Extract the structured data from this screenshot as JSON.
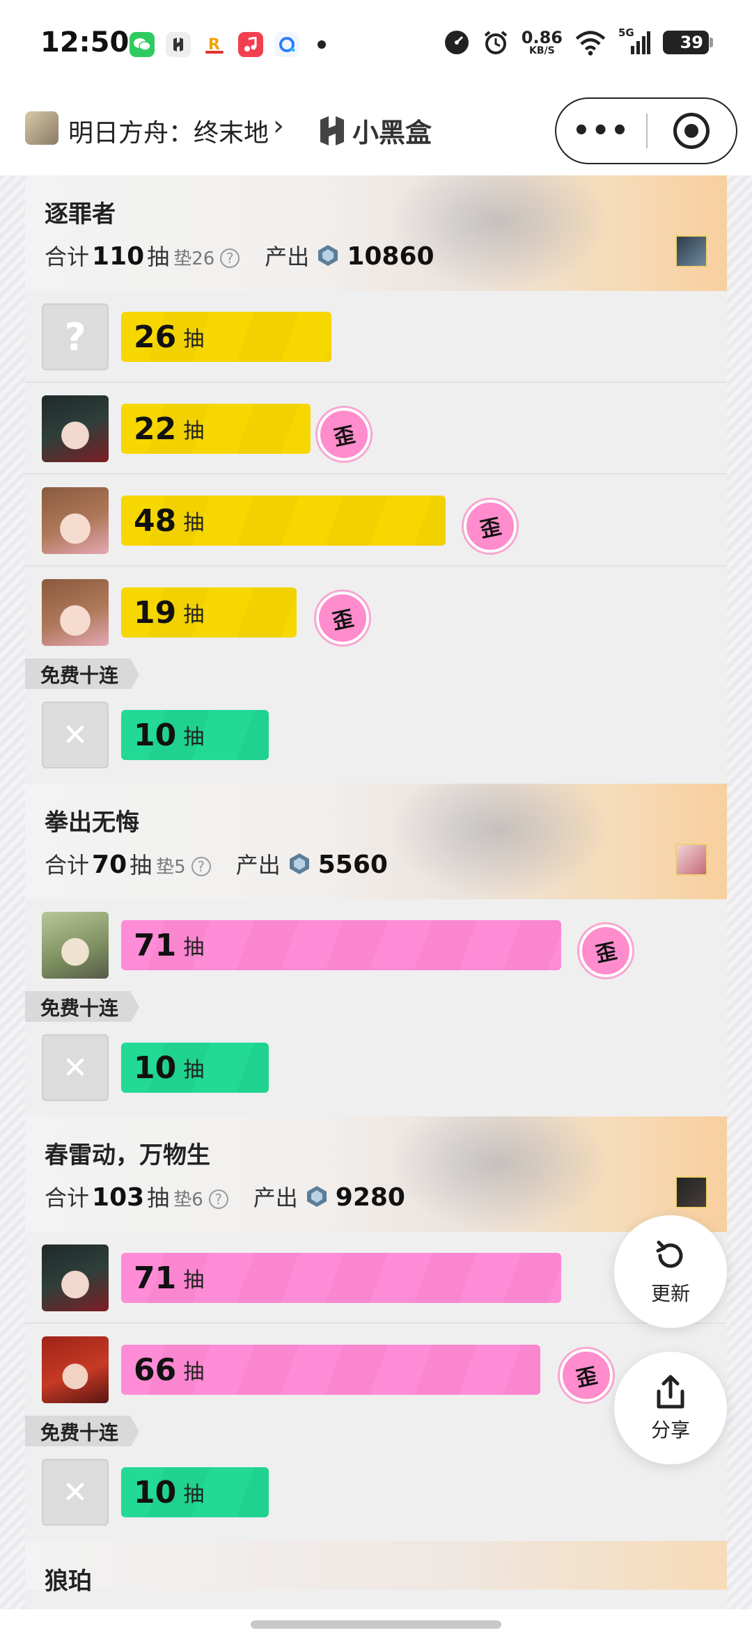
{
  "status_bar": {
    "time": "12:50",
    "net_speed_value": "0.86",
    "net_speed_unit": "KB/S",
    "network": "5G",
    "battery": "39"
  },
  "nav": {
    "title": "明日方舟：终末地",
    "brand": "小黑盒",
    "more_label": "•••"
  },
  "labels": {
    "total_prefix": "合计",
    "pull_unit": "抽",
    "pity_prefix": "垫",
    "produce": "产出",
    "off_banner": "歪",
    "free_ten": "免费十连",
    "help": "?"
  },
  "banners": [
    {
      "name": "逐罪者",
      "total": "110",
      "pity": "26",
      "produce": "10860",
      "rows": [
        {
          "pulls": "26",
          "color": "yellow",
          "fill": 0.48,
          "off": false,
          "avatar": "unknown"
        },
        {
          "pulls": "22",
          "color": "yellow",
          "fill": 0.43,
          "off": true,
          "avatar": "dark-hair"
        },
        {
          "pulls": "48",
          "color": "yellow",
          "fill": 0.74,
          "off": true,
          "avatar": "brown-hair"
        },
        {
          "pulls": "19",
          "color": "yellow",
          "fill": 0.4,
          "off": true,
          "avatar": "brown-hair"
        }
      ],
      "free": {
        "pulls": "10"
      }
    },
    {
      "name": "拳出无悔",
      "total": "70",
      "pity": "5",
      "produce": "5560",
      "rows": [
        {
          "pulls": "71",
          "color": "pink",
          "fill": 1.0,
          "off": true,
          "avatar": "green-hair"
        }
      ],
      "free": {
        "pulls": "10"
      }
    },
    {
      "name": "春雷动，万物生",
      "total": "103",
      "pity": "6",
      "produce": "9280",
      "rows": [
        {
          "pulls": "71",
          "color": "pink",
          "fill": 1.0,
          "off": false,
          "avatar": "dark-hair"
        },
        {
          "pulls": "66",
          "color": "pink",
          "fill": 0.95,
          "off": true,
          "avatar": "red-hair"
        }
      ],
      "free": {
        "pulls": "10"
      }
    },
    {
      "name": "狼珀"
    }
  ],
  "fab": {
    "refresh": "更新",
    "share": "分享"
  },
  "colors": {
    "yellow": "#f7d700",
    "pink": "#ff8cd6",
    "green": "#23d996",
    "off_badge": "#ff8ccc"
  }
}
